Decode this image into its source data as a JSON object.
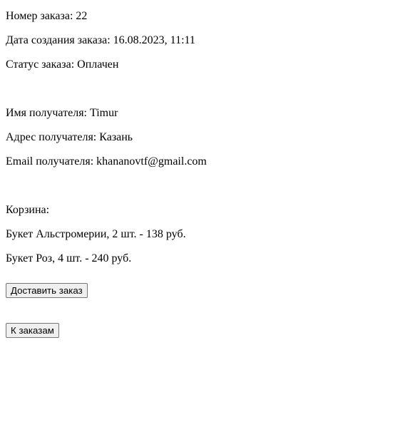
{
  "order": {
    "number": "Номер заказа: 22",
    "created": "Дата создания заказа: 16.08.2023, 11:11",
    "status": "Статус заказа: Оплачен"
  },
  "recipient": {
    "name": "Имя получателя: Timur",
    "address": "Адрес получателя: Казань",
    "email": "Email получателя: khananovtf@gmail.com"
  },
  "cart": {
    "title": "Корзина:",
    "items": [
      "Букет Альстромерии, 2 шт. - 138 руб.",
      "Букет Роз, 4 шт. - 240 руб."
    ]
  },
  "actions": {
    "deliver_label": "Доставить заказ",
    "back_label": "К заказам"
  }
}
